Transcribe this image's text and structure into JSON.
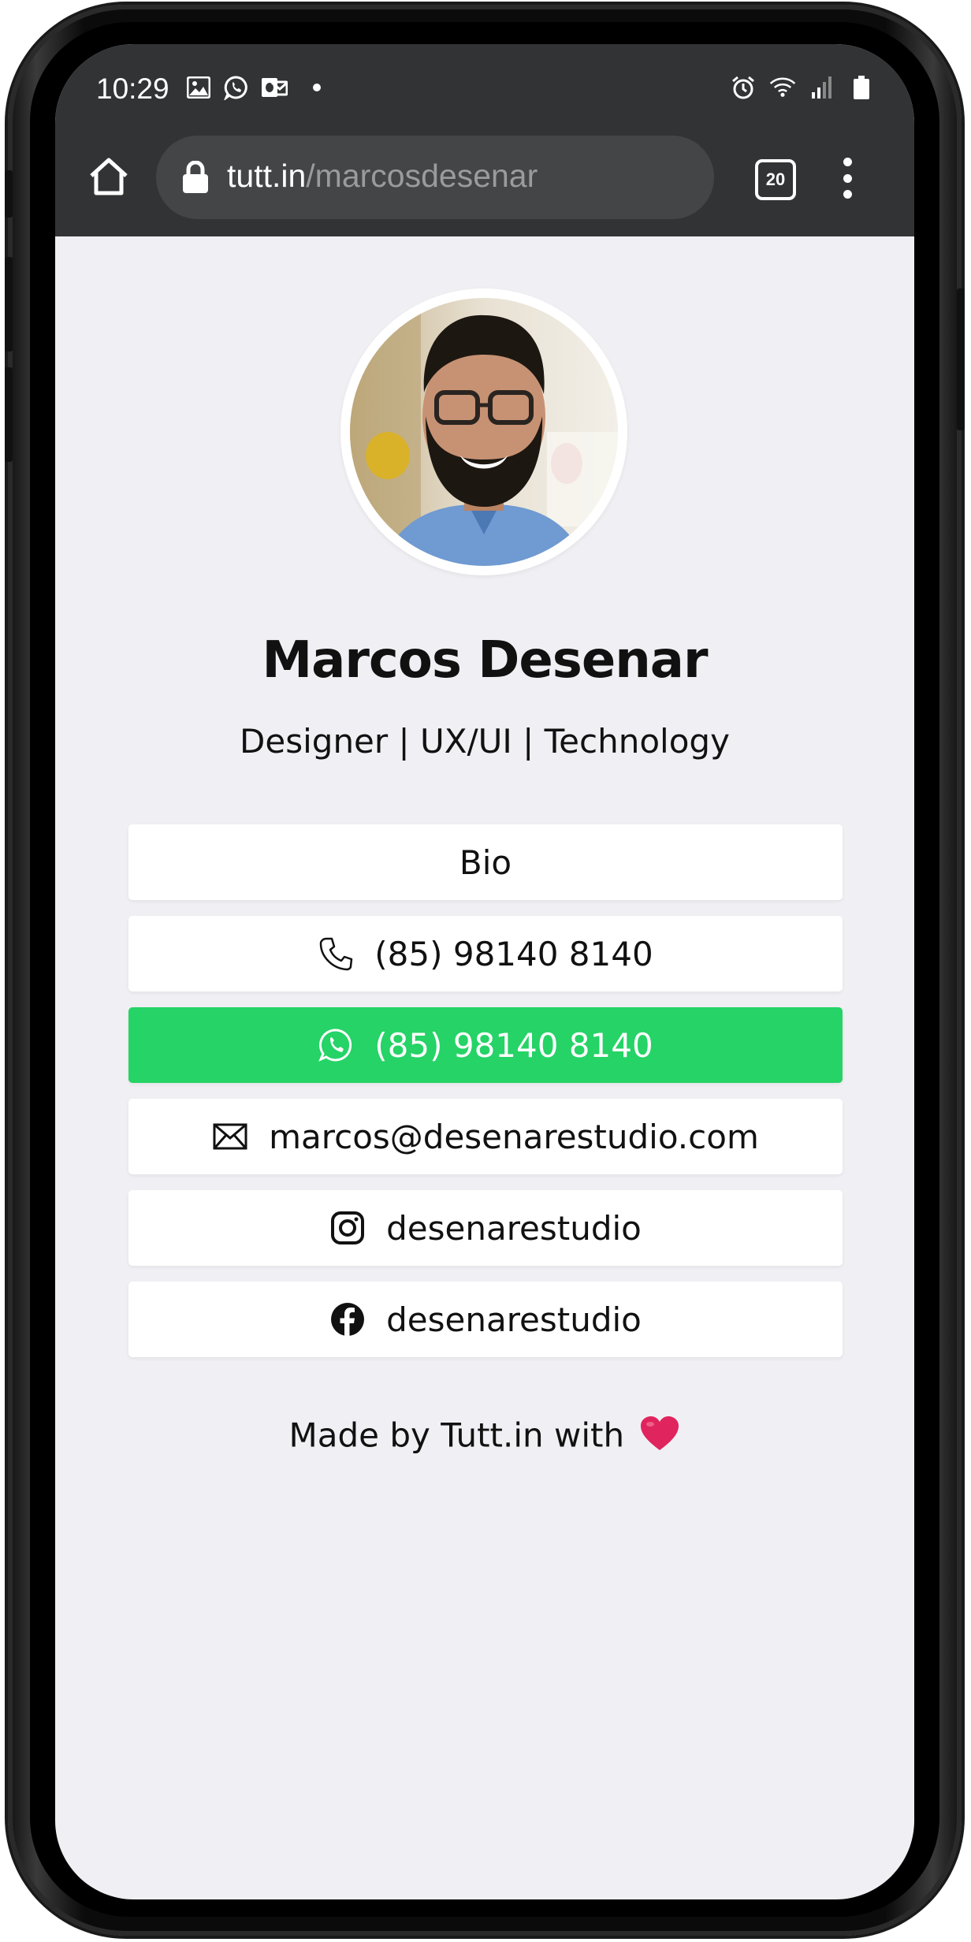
{
  "status_bar": {
    "time": "10:29",
    "left_icons": [
      "image-notification-icon",
      "whatsapp-notification-icon",
      "outlook-notification-icon",
      "more-dot-icon"
    ],
    "right_icons": [
      "alarm-icon",
      "wifi-icon",
      "signal-icon",
      "battery-icon"
    ]
  },
  "browser": {
    "url_domain": "tutt.in",
    "url_path": "/marcosdesenar",
    "tab_count": "20"
  },
  "profile": {
    "name": "Marcos Desenar",
    "tagline": "Designer | UX/UI | Technology"
  },
  "links": [
    {
      "label": "Bio",
      "icon": "",
      "style": "default"
    },
    {
      "label": "(85) 98140 8140",
      "icon": "phone-icon",
      "style": "default"
    },
    {
      "label": "(85) 98140 8140",
      "icon": "whatsapp-icon",
      "style": "whatsapp"
    },
    {
      "label": "marcos@desenarestudio.com",
      "icon": "mail-icon",
      "style": "default"
    },
    {
      "label": "desenarestudio",
      "icon": "instagram-icon",
      "style": "default"
    },
    {
      "label": "desenarestudio",
      "icon": "facebook-icon",
      "style": "default"
    }
  ],
  "footer": {
    "text": "Made by Tutt.in with"
  },
  "colors": {
    "page_bg": "#f0f0f4",
    "chrome_bg": "#323335",
    "whatsapp_green": "#25d366",
    "heart_red": "#e0245e"
  }
}
